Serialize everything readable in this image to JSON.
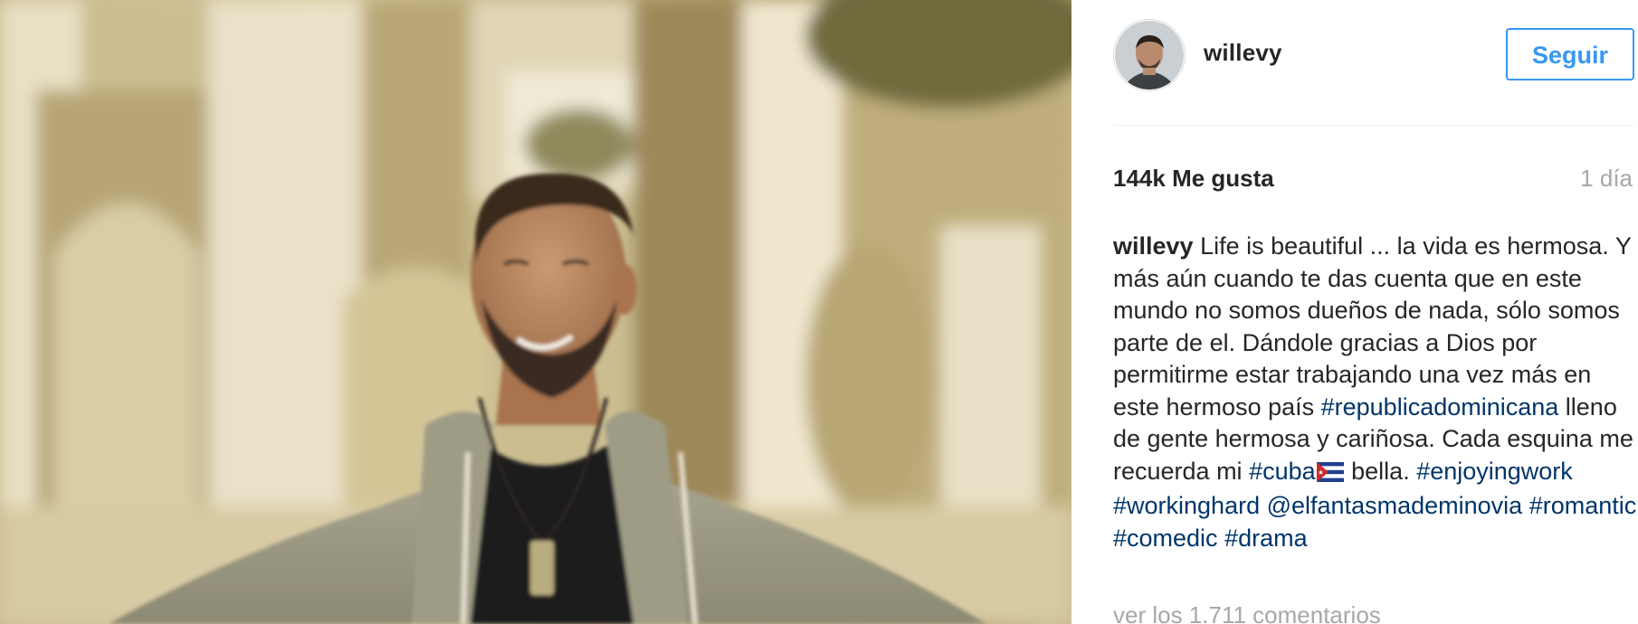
{
  "post": {
    "username": "willevy",
    "follow_label": "Seguir",
    "likes": "144k Me gusta",
    "time_ago": "1 día",
    "caption": {
      "author": "willevy",
      "segments": [
        {
          "type": "text",
          "text": " Life is beautiful ... la vida es hermosa. Y más aún cuando te das cuenta que en este mundo no somos dueños de nada, sólo somos parte de el. Dándole gracias a Dios por permitirme estar trabajando una vez más en este hermoso país "
        },
        {
          "type": "tag",
          "text": "#republicadominicana"
        },
        {
          "type": "text",
          "text": " lleno de gente hermosa y cariñosa. Cada esquina me recuerda mi "
        },
        {
          "type": "tag",
          "text": "#cuba"
        },
        {
          "type": "flag",
          "text": ""
        },
        {
          "type": "text",
          "text": " bella. "
        },
        {
          "type": "tag",
          "text": "#enjoyingwork"
        },
        {
          "type": "text",
          "text": " "
        },
        {
          "type": "tag",
          "text": "#workinghard"
        },
        {
          "type": "text",
          "text": " "
        },
        {
          "type": "tag",
          "text": "@elfantasmademinovia"
        },
        {
          "type": "text",
          "text": " "
        },
        {
          "type": "tag",
          "text": "#romantic"
        },
        {
          "type": "text",
          "text": " "
        },
        {
          "type": "tag",
          "text": "#comedic"
        },
        {
          "type": "text",
          "text": " "
        },
        {
          "type": "tag",
          "text": "#drama"
        }
      ]
    },
    "view_comments": "ver los 1.711 comentarios"
  },
  "icons": {
    "avatar": "profile-avatar",
    "flag": "cuba-flag-icon"
  },
  "colors": {
    "follow_blue": "#3897f0",
    "tag_blue": "#003569",
    "muted_gray": "#a5a7aa",
    "text_dark": "#262626"
  }
}
